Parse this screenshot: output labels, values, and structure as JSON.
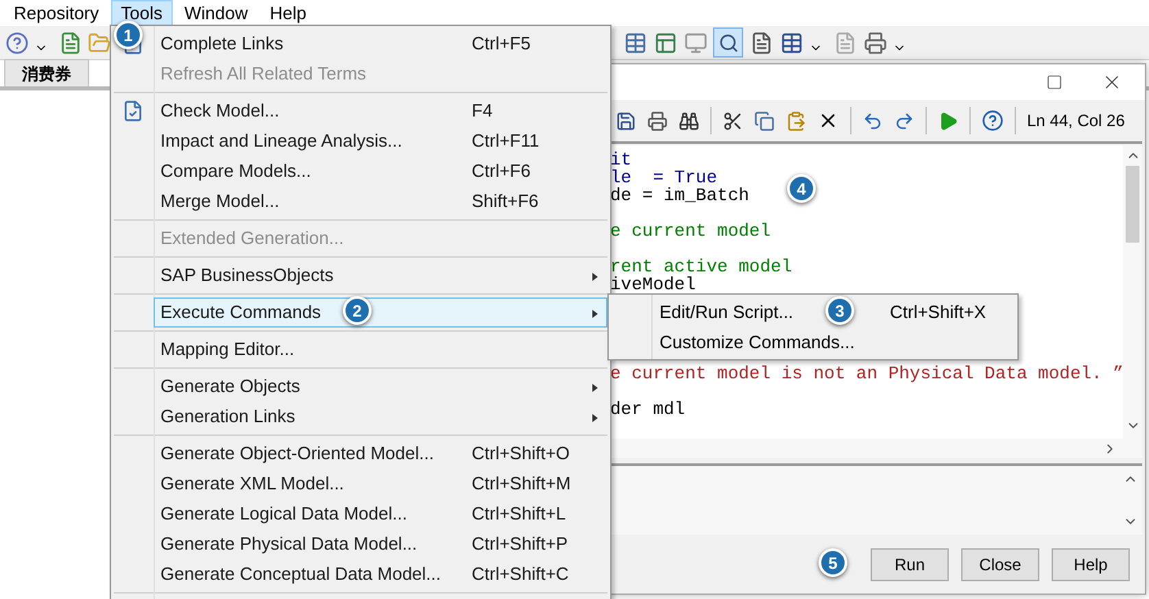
{
  "menu_bar": [
    {
      "label": "Repository",
      "selected": false
    },
    {
      "label": "Tools",
      "selected": true
    },
    {
      "label": "Window",
      "selected": false
    },
    {
      "label": "Help",
      "selected": false
    }
  ],
  "document_tab": {
    "label": "消费券"
  },
  "tools_menu": {
    "groups": [
      [
        {
          "label": "Complete Links",
          "shortcut": "Ctrl+F5",
          "disabled": false,
          "selected": false,
          "submenu": false,
          "has_icon": true
        },
        {
          "label": "Refresh All Related Terms",
          "disabled": true,
          "selected": false,
          "submenu": false,
          "has_icon": false
        }
      ],
      [
        {
          "label": "Check Model...",
          "shortcut": "F4",
          "disabled": false,
          "selected": false,
          "submenu": false,
          "has_icon": true
        },
        {
          "label": "Impact and Lineage Analysis...",
          "shortcut": "Ctrl+F11",
          "disabled": false,
          "selected": false,
          "submenu": false,
          "has_icon": false
        },
        {
          "label": "Compare Models...",
          "shortcut": "Ctrl+F6",
          "disabled": false,
          "selected": false,
          "submenu": false,
          "has_icon": false
        },
        {
          "label": "Merge Model...",
          "shortcut": "Shift+F6",
          "disabled": false,
          "selected": false,
          "submenu": false,
          "has_icon": false
        }
      ],
      [
        {
          "label": "Extended Generation...",
          "disabled": true,
          "selected": false,
          "submenu": false,
          "has_icon": false
        }
      ],
      [
        {
          "label": "SAP BusinessObjects",
          "disabled": false,
          "selected": false,
          "submenu": true,
          "has_icon": false
        }
      ],
      [
        {
          "label": "Execute Commands",
          "disabled": false,
          "selected": true,
          "submenu": true,
          "has_icon": false
        }
      ],
      [
        {
          "label": "Mapping Editor...",
          "disabled": false,
          "selected": false,
          "submenu": false,
          "has_icon": false
        }
      ],
      [
        {
          "label": "Generate Objects",
          "disabled": false,
          "selected": false,
          "submenu": true,
          "has_icon": false
        },
        {
          "label": "Generation Links",
          "disabled": false,
          "selected": false,
          "submenu": true,
          "has_icon": false
        }
      ],
      [
        {
          "label": "Generate Object-Oriented Model...",
          "shortcut": "Ctrl+Shift+O",
          "disabled": false,
          "selected": false,
          "submenu": false,
          "has_icon": false
        },
        {
          "label": "Generate XML Model...",
          "shortcut": "Ctrl+Shift+M",
          "disabled": false,
          "selected": false,
          "submenu": false,
          "has_icon": false
        },
        {
          "label": "Generate Logical Data Model...",
          "shortcut": "Ctrl+Shift+L",
          "disabled": false,
          "selected": false,
          "submenu": false,
          "has_icon": false
        },
        {
          "label": "Generate Physical Data Model...",
          "shortcut": "Ctrl+Shift+P",
          "disabled": false,
          "selected": false,
          "submenu": false,
          "has_icon": false
        },
        {
          "label": "Generate Conceptual Data Model...",
          "shortcut": "Ctrl+Shift+C",
          "disabled": false,
          "selected": false,
          "submenu": false,
          "has_icon": false
        }
      ]
    ]
  },
  "execute_submenu": [
    {
      "label": "Edit/Run Script...",
      "shortcut": "Ctrl+Shift+X"
    },
    {
      "label": "Customize Commands..."
    }
  ],
  "script_dialog": {
    "cursor_position": "Ln 44, Col 26",
    "code_lines": [
      {
        "kind": "code",
        "text": "it",
        "color": "#00008b"
      },
      {
        "kind": "code",
        "text": "le  = True",
        "color": "#00008b"
      },
      {
        "kind": "code",
        "text": "de = im_Batch",
        "color": "#000000"
      },
      {
        "kind": "blank"
      },
      {
        "kind": "code",
        "text": "e current model",
        "color": "#008000"
      },
      {
        "kind": "blank"
      },
      {
        "kind": "code",
        "text": "rent active model",
        "color": "#008000"
      },
      {
        "kind": "code",
        "text": "iveModel",
        "color": "#000000"
      },
      {
        "kind": "blank"
      },
      {
        "kind": "blank"
      },
      {
        "kind": "blank"
      },
      {
        "kind": "blank"
      },
      {
        "kind": "code",
        "text": "e current model is not an Physical Data model. ”",
        "color": "#b22222"
      },
      {
        "kind": "blank"
      },
      {
        "kind": "code",
        "text": "der mdl",
        "color": "#000000"
      }
    ],
    "buttons": [
      "Run",
      "Close",
      "Help"
    ]
  },
  "callouts": [
    "1",
    "2",
    "3",
    "4",
    "5"
  ]
}
